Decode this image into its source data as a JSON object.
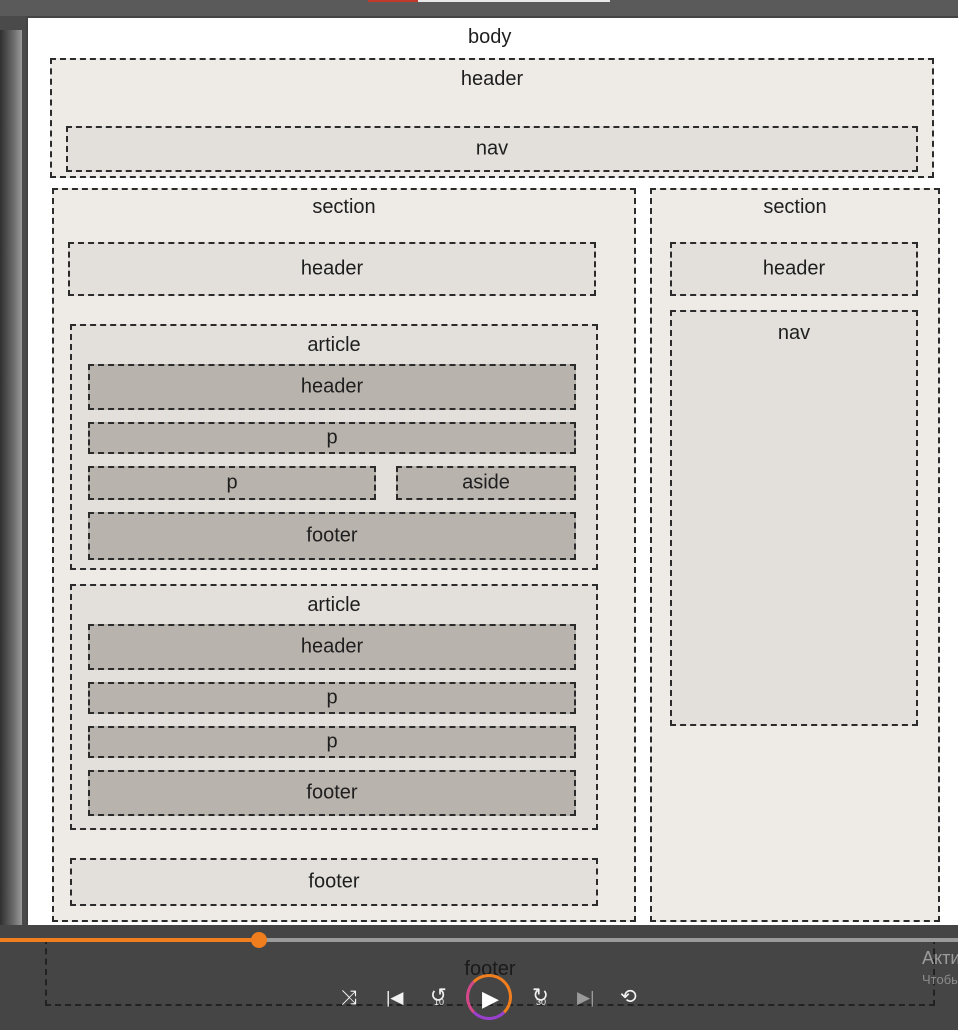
{
  "diagram": {
    "body": "body",
    "page_header": {
      "label": "header",
      "nav": "nav"
    },
    "main_section": {
      "label": "section",
      "header": "header",
      "article1": {
        "label": "article",
        "header": "header",
        "p1": "p",
        "p2": "p",
        "aside": "aside",
        "footer": "footer"
      },
      "article2": {
        "label": "article",
        "header": "header",
        "p1": "p",
        "p2": "p",
        "footer": "footer"
      },
      "footer": "footer"
    },
    "side_section": {
      "label": "section",
      "header": "header",
      "nav": "nav"
    },
    "page_footer": "footer"
  },
  "player": {
    "progress_fraction": 0.27,
    "icons": [
      "shuffle-icon",
      "skip-previous-icon",
      "rewind-10-icon",
      "play-icon",
      "forward-30-icon",
      "skip-next-icon",
      "repeat-off-icon"
    ],
    "rewind_label": "10",
    "forward_label": "30"
  },
  "watermark": {
    "line1": "Акти",
    "line2": "Чтобы"
  }
}
